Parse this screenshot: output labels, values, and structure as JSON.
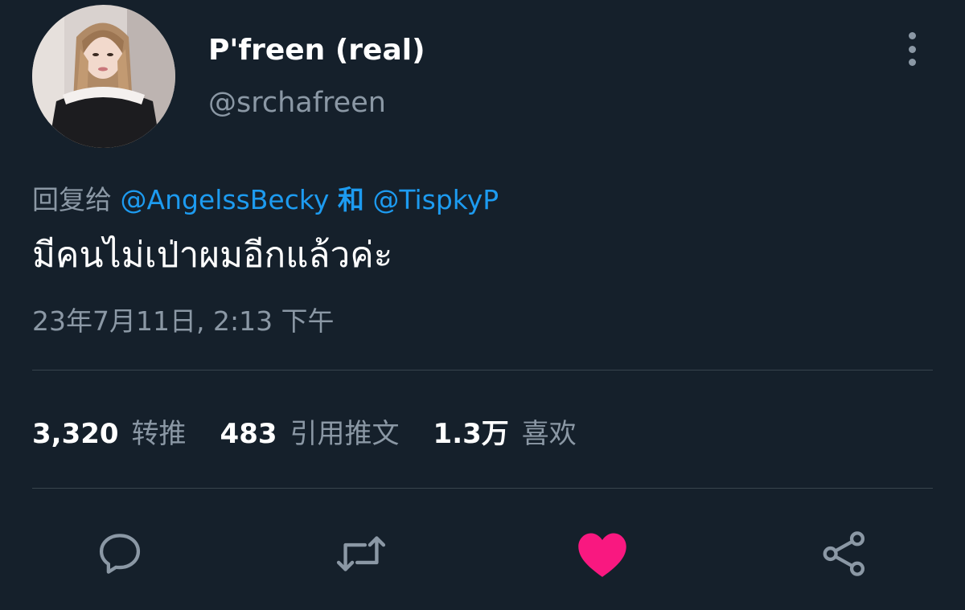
{
  "tweet": {
    "author": {
      "display_name": "P'freen (real)",
      "handle": "@srchafreen"
    },
    "reply": {
      "prefix": "回复给",
      "user_one": "@AngelssBecky",
      "joiner": "和",
      "user_two": "@TispkyP"
    },
    "text": "มีคนไม่เป่าผมอีกแล้วค่ะ",
    "timestamp": "23年7月11日, 2:13 下午"
  },
  "stats": {
    "retweets": {
      "value": "3,320",
      "label": "转推"
    },
    "quotes": {
      "value": "483",
      "label": "引用推文"
    },
    "likes": {
      "value": "1.3万",
      "label": "喜欢"
    }
  },
  "actions": {
    "reply_icon": "speech-bubble-icon",
    "retweet_icon": "retweet-arrows-icon",
    "like_icon": "heart-icon",
    "like_active": true,
    "share_icon": "share-nodes-icon"
  },
  "colors": {
    "background": "#15202b",
    "text_primary": "#ffffff",
    "text_secondary": "#8b98a5",
    "link": "#1d9bf0",
    "like_active": "#f91880",
    "divider": "#38444d"
  }
}
